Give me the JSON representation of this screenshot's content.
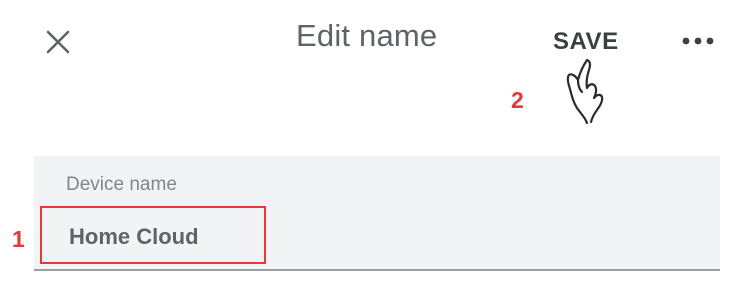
{
  "header": {
    "title": "Edit name",
    "save_label": "SAVE",
    "close_icon": "close-icon",
    "more_icon": "more-horizontal-icon"
  },
  "annotations": {
    "step_1": "1",
    "step_2": "2",
    "pointer_icon": "hand-pointer-icon",
    "highlight_color": "#e53935"
  },
  "form": {
    "device_name_label": "Device name",
    "device_name_value": "Home Cloud"
  }
}
